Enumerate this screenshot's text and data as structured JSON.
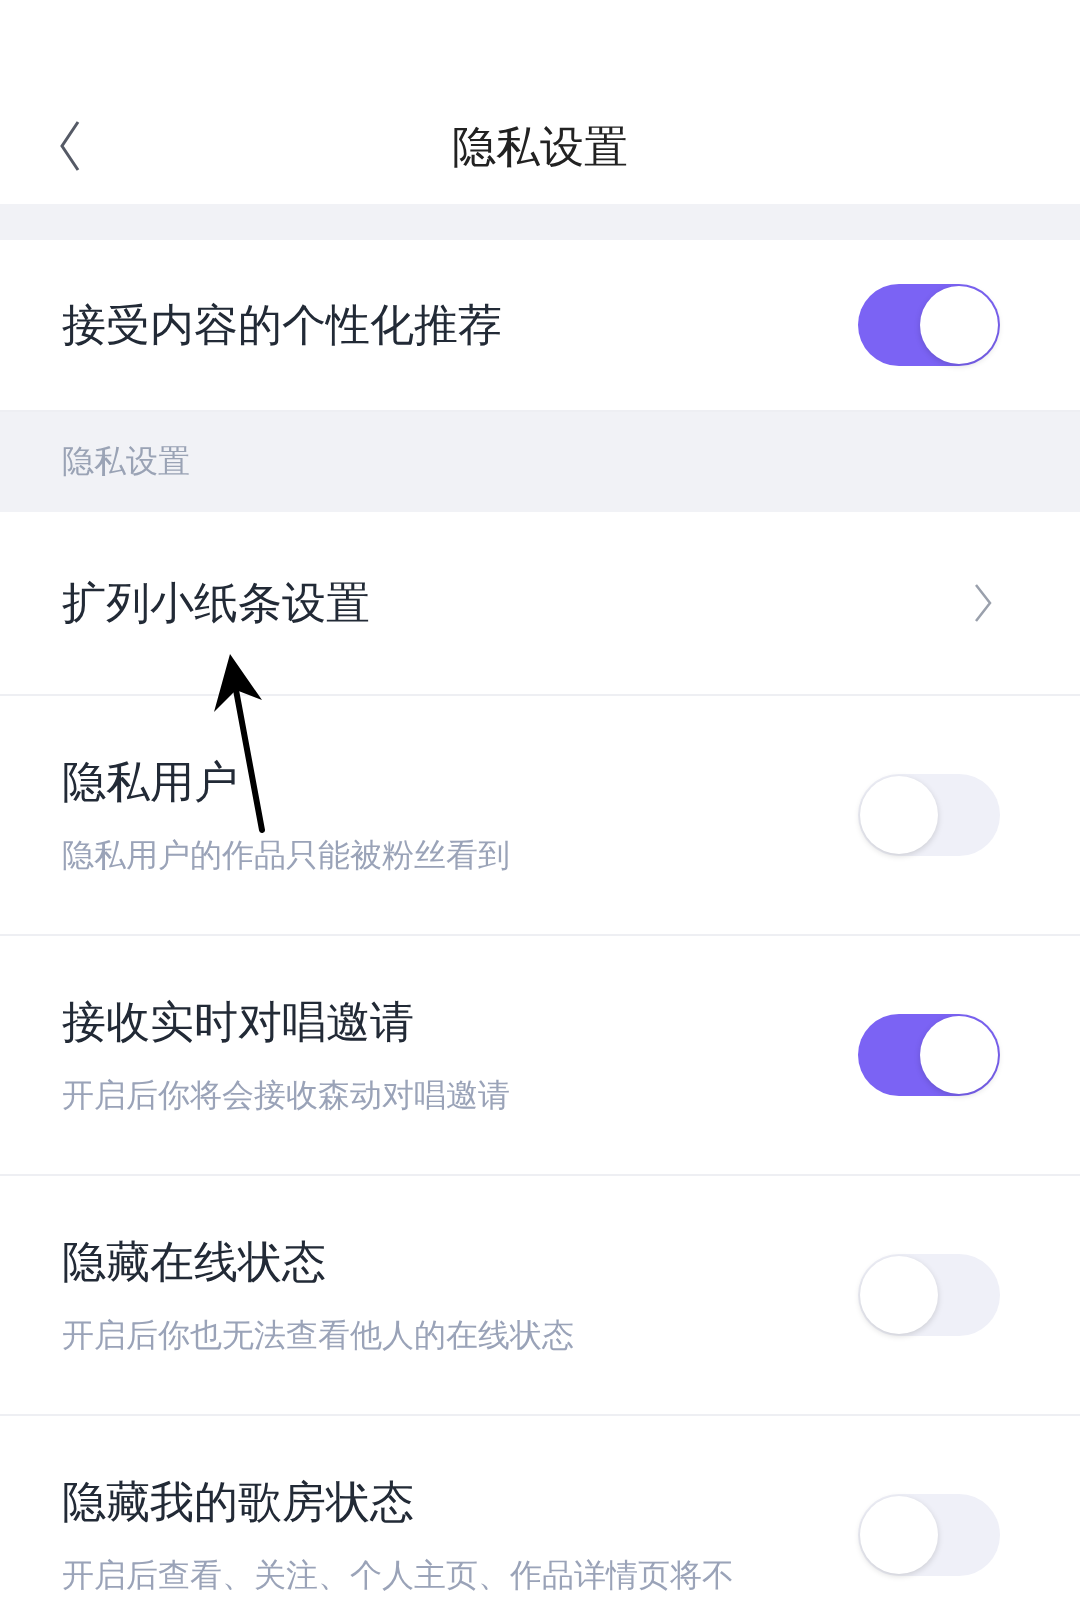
{
  "nav": {
    "title": "隐私设置"
  },
  "sections": [
    {
      "rows": [
        {
          "kind": "toggle",
          "title": "接受内容的个性化推荐",
          "on": true
        }
      ]
    },
    {
      "header": "隐私设置",
      "rows": [
        {
          "kind": "link",
          "title": "扩列小纸条设置"
        },
        {
          "kind": "toggle",
          "title": "隐私用户",
          "subtitle": "隐私用户的作品只能被粉丝看到",
          "on": false
        },
        {
          "kind": "toggle",
          "title": "接收实时对唱邀请",
          "subtitle": "开启后你将会接收森动对唱邀请",
          "on": true
        },
        {
          "kind": "toggle",
          "title": "隐藏在线状态",
          "subtitle": "开启后你也无法查看他人的在线状态",
          "on": false
        },
        {
          "kind": "toggle",
          "title": "隐藏我的歌房状态",
          "subtitle": "开启后查看、关注、个人主页、作品详情页将不",
          "on": false
        }
      ]
    }
  ]
}
